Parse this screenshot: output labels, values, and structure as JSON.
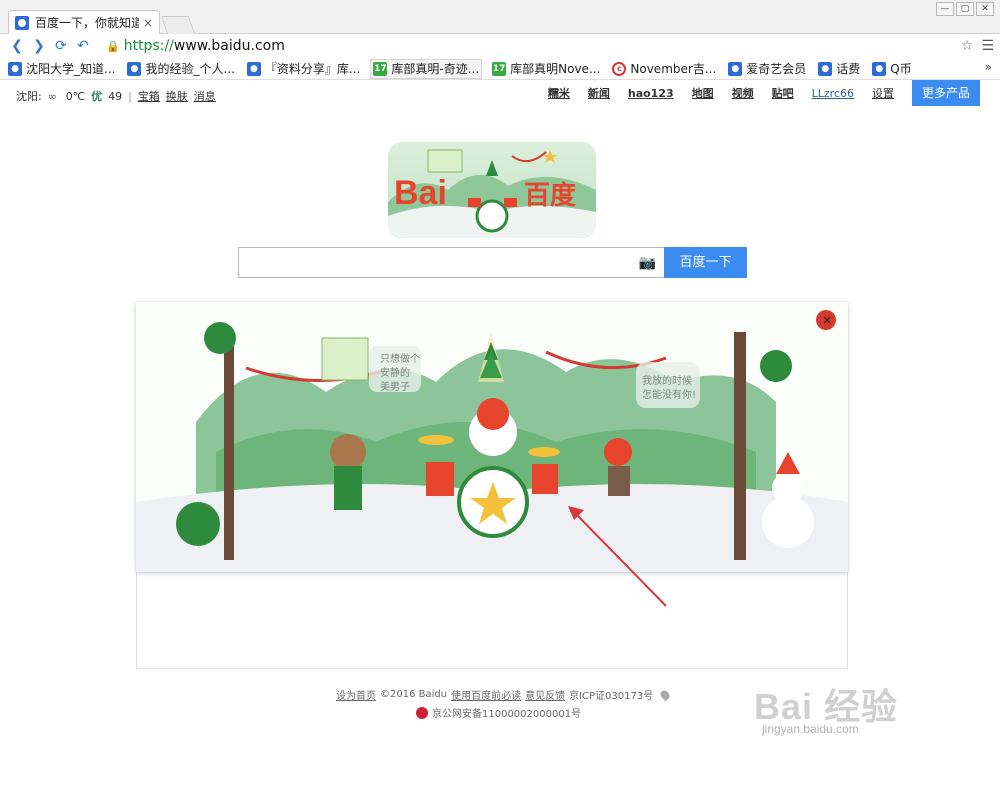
{
  "browser": {
    "tab_title": "百度一下，你就知道",
    "tab_close": "×",
    "window_buttons": [
      "—",
      "▢",
      "✕"
    ],
    "url_scheme": "https://",
    "url_host": "www.baidu.com",
    "bookmarks": [
      {
        "icon": "paw-icon",
        "label": "沈阳大学_知道..."
      },
      {
        "icon": "paw-icon",
        "label": "我的经验_个人..."
      },
      {
        "icon": "paw-icon",
        "label": "『资料分享』库..."
      },
      {
        "icon": "seventeen-icon",
        "label": "库部真明-奇迹..."
      },
      {
        "icon": "seventeen-icon",
        "label": "库部真明Nove..."
      },
      {
        "icon": "c-icon",
        "label": "November吉..."
      },
      {
        "icon": "paw-icon",
        "label": "爱奇艺会员"
      },
      {
        "icon": "paw-icon",
        "label": "话费"
      },
      {
        "icon": "paw-icon",
        "label": "Q币"
      }
    ],
    "bookmarks_more": "»"
  },
  "page": {
    "topbar_left": {
      "city": "沈阳:",
      "temp": "0℃",
      "aqi_label": "优",
      "aqi_value": "49",
      "separator": "|",
      "links": [
        "宝箱",
        "换肤",
        "消息"
      ]
    },
    "topbar_right": {
      "links": [
        "糯米",
        "新闻",
        "hao123",
        "地图",
        "视频",
        "贴吧"
      ],
      "user": "LLzrc66",
      "settings": "设置",
      "more_products": "更多产品"
    },
    "search": {
      "placeholder": "",
      "button": "百度一下"
    },
    "doodle_text": {
      "logo_left": "Bai",
      "logo_right": "百度",
      "bubble_left_lines": [
        "只想做个",
        "安静的",
        "美男子"
      ],
      "bubble_right_lines": [
        "我放的时候",
        "怎能没有你!"
      ]
    },
    "footer": {
      "set_home": "设为首页",
      "copyright": "©2016 Baidu",
      "terms": "使用百度前必读",
      "feedback": "意见反馈",
      "icp": "京ICP证030173号",
      "police": "京公网安备11000002000001号"
    },
    "watermark": {
      "main": "Bai 经验",
      "sub": "jingyan.baidu.com"
    }
  },
  "colors": {
    "accent_blue": "#3b8cf0",
    "link_blue": "#2b5ca8",
    "aqi_green": "#2e8b57"
  }
}
